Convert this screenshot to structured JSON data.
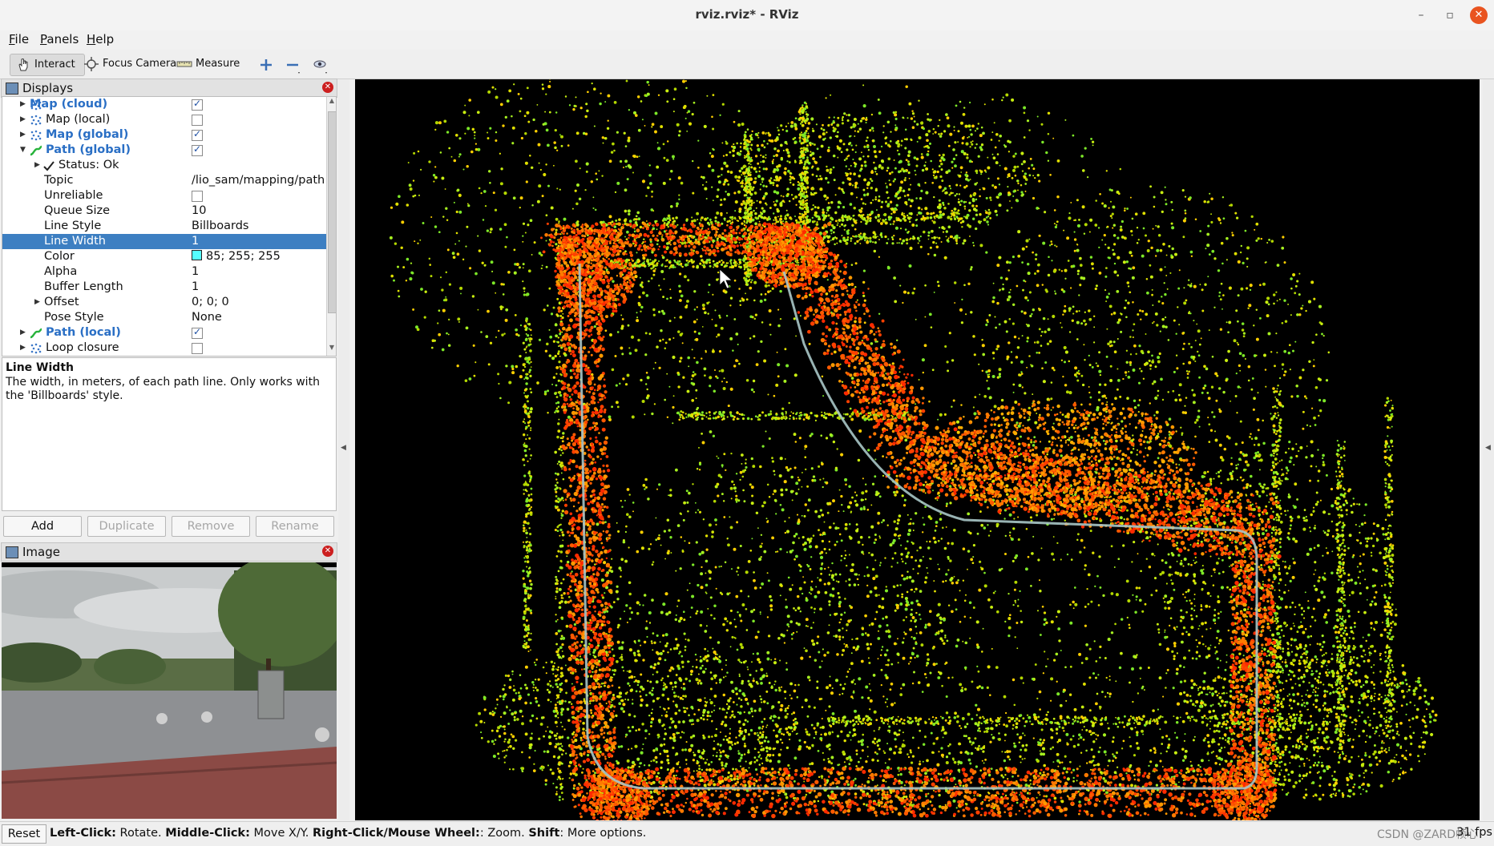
{
  "window": {
    "title": "rviz.rviz* - RViz",
    "controls": {
      "minimize": "–",
      "maximize": "▫",
      "close": "✕"
    }
  },
  "menu": {
    "file": "File",
    "panels": "Panels",
    "help": "Help"
  },
  "toolbar": {
    "interact": "Interact",
    "focus_camera": "Focus Camera",
    "measure": "Measure"
  },
  "displays": {
    "title": "Displays",
    "rows": [
      {
        "name": "Map (cloud)",
        "checked": true,
        "blue": true
      },
      {
        "name": "Map (local)",
        "checked": false,
        "blue": false
      },
      {
        "name": "Map (global)",
        "checked": true,
        "blue": true
      },
      {
        "name": "Path (global)",
        "checked": true,
        "blue": true
      },
      {
        "name": "Status: Ok"
      },
      {
        "name": "Topic",
        "value": "/lio_sam/mapping/path"
      },
      {
        "name": "Unreliable",
        "checked": false
      },
      {
        "name": "Queue Size",
        "value": "10"
      },
      {
        "name": "Line Style",
        "value": "Billboards"
      },
      {
        "name": "Line Width",
        "value": "1"
      },
      {
        "name": "Color",
        "value": "85; 255; 255",
        "color": "#55ffff"
      },
      {
        "name": "Alpha",
        "value": "1"
      },
      {
        "name": "Buffer Length",
        "value": "1"
      },
      {
        "name": "Offset",
        "value": "0; 0; 0"
      },
      {
        "name": "Pose Style",
        "value": "None"
      },
      {
        "name": "Path (local)",
        "checked": true,
        "blue": true
      },
      {
        "name": "Loop closure",
        "checked": false
      }
    ],
    "description_title": "Line Width",
    "description_text": "The width, in meters, of each path line. Only works with the 'Billboards' style.",
    "buttons": {
      "add": "Add",
      "duplicate": "Duplicate",
      "remove": "Remove",
      "rename": "Rename"
    }
  },
  "image_panel": {
    "title": "Image"
  },
  "status": {
    "reset": "Reset",
    "help_parts": [
      {
        "bold": "Left-Click:",
        "text": " Rotate. "
      },
      {
        "bold": "Middle-Click:",
        "text": " Move X/Y. "
      },
      {
        "bold": "Right-Click/Mouse Wheel:",
        "text": ": Zoom. "
      },
      {
        "bold": "Shift",
        "text": ": More options."
      }
    ],
    "fps": "31 fps",
    "watermark": "CSDN @ZARD帧心"
  },
  "colors": {
    "selection": "#3d7fc2",
    "accent_blue": "#2a6fc5",
    "path_color": "#55ffff",
    "close_btn": "#e95420"
  }
}
